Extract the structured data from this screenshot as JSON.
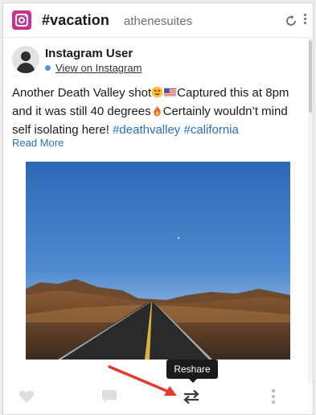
{
  "header": {
    "title": "#vacation",
    "subtitle": "athenesuites",
    "icons": [
      "instagram-icon",
      "refresh-icon",
      "more-vertical-icon"
    ]
  },
  "post": {
    "user_name": "Instagram User",
    "view_link": "View on Instagram",
    "text_segments": {
      "part1": "Another Death Valley shot",
      "part2": "Captured this at 8pm and it was still 40 degrees",
      "part3": "Certainly wouldn’t mind self isolating here! ",
      "hashtag1": "#deathvalley",
      "space": " ",
      "hashtag2": "#california"
    },
    "read_more": "Read More",
    "image_subject": "desert road at dusk"
  },
  "footer": {
    "tooltip": "Reshare",
    "icons": [
      "heart-icon",
      "comment-icon",
      "reshare-icon",
      "more-vertical-icon"
    ]
  },
  "colors": {
    "instagram_brand": "#c8338f",
    "link": "#2a6fb7",
    "annotation_arrow": "#e53b2f",
    "tooltip_bg": "#1b1b1b"
  }
}
